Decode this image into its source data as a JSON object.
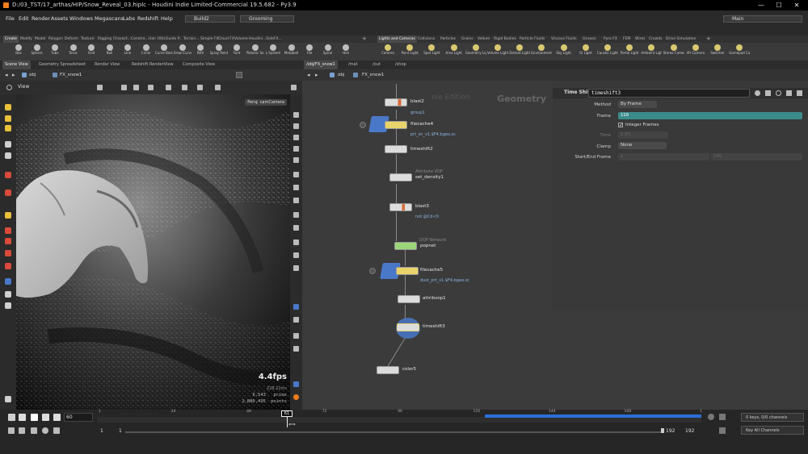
{
  "window": {
    "title": "D:/03_TST/17_arthas/HIP/Snow_Reveal_03.hiplc - Houdini Indie Limited-Commercial 19.5.682 - Py3.9",
    "minimize": "—",
    "maximize": "☐",
    "close": "✕"
  },
  "menu": {
    "items": [
      "File",
      "Edit",
      "Render",
      "Assets",
      "Windows",
      "Megascans",
      "Labs",
      "Redshift",
      "Help"
    ],
    "build": "Build2",
    "desktop": "Grooming",
    "main": "Main"
  },
  "shelf_tabs_left": [
    "Create",
    "Modify",
    "Model",
    "Polygon",
    "Deform",
    "Texture",
    "Rigging",
    "Charact...",
    "Constra...",
    "Hair Utils",
    "Guide P...",
    "Terrain...",
    "Simple FX",
    "Cloud FX",
    "Volume",
    "Houdini...",
    "SideFX..."
  ],
  "shelf_tabs_right": [
    "Lights and Cameras",
    "Collisions",
    "Particles",
    "Grains",
    "Vellum",
    "Rigid Bodies",
    "Particle Fluids",
    "Viscous Fluids",
    "Oceans",
    "Pyro FX",
    "FEM",
    "Wires",
    "Crowds",
    "Drive Simulation"
  ],
  "shelf_tools_left": [
    "Box",
    "Sphere",
    "Tube",
    "Torus",
    "Grid",
    "Null",
    "Line",
    "Circle",
    "Curve Bezier",
    "Draw Curve",
    "Path",
    "Spray Paint",
    "Font",
    "Platonic Solids",
    "L-System",
    "Metaball",
    "File",
    "Spiral",
    "Heli"
  ],
  "shelf_tools_right": [
    "Camera",
    "Point Light",
    "Spot Light",
    "Area Light",
    "Geometry Light",
    "Volume Light",
    "Distant Light",
    "Environment Light",
    "Sky Light",
    "GI Light",
    "Caustic Light",
    "Portal Light",
    "Ambient Light",
    "Stereo Camera",
    "VR Camera",
    "Switcher",
    "Gamepad Camera"
  ],
  "pane_tabs_left": [
    "Scene View",
    "Geometry Spreadsheet",
    "Render View",
    "Redshift RenderView",
    "Composite View"
  ],
  "pane_tabs_right": [
    "/obj/FX_snow1",
    "/mat",
    "/out",
    "/shop"
  ],
  "paths": {
    "left_obj": "obj",
    "left_node": "FX_snow1",
    "right_obj": "obj",
    "right_node": "FX_snow1"
  },
  "viewport": {
    "label": "View",
    "persp": "Persp",
    "camera": "camCamera",
    "fps": "4.4fps",
    "ms": "228.22ms",
    "prims_value": "6,543",
    "prims_label": "prims",
    "points_value": "2,880,495",
    "points_label": "points"
  },
  "network": {
    "context": "Geometry",
    "watermark": "nie Edition",
    "nodes": [
      {
        "name": "blast2",
        "sub": "group1",
        "comment": ""
      },
      {
        "name": "filecache4",
        "sub": "prt_sn_v1.$F4.bgeo.sc",
        "comment": ""
      },
      {
        "name": "timeshift2",
        "sub": "",
        "comment": ""
      },
      {
        "name": "set_density1",
        "sub": "",
        "comment": "Attribute VOP"
      },
      {
        "name": "blast3",
        "sub": "not @Cd<0",
        "comment": ""
      },
      {
        "name": "popnet",
        "sub": "",
        "comment": "DOP Network"
      },
      {
        "name": "filecache5",
        "sub": "dust_prt_v1.$F4.bgeo.sc",
        "comment": ""
      },
      {
        "name": "attribvop1",
        "sub": "",
        "comment": ""
      },
      {
        "name": "timeshift3",
        "sub": "",
        "comment": ""
      },
      {
        "name": "color5",
        "sub": "",
        "comment": ""
      }
    ]
  },
  "params": {
    "node_type": "Time Shift",
    "node_name": "timeshift3",
    "method_label": "Method",
    "method_value": "By Frame",
    "frame_label": "Frame",
    "frame_value": "110",
    "integer_frames_label": "Integer Frames",
    "time_label": "Time",
    "time_value": "1.85",
    "clamp_label": "Clamp",
    "clamp_value": "None",
    "startend_label": "Start/End Frame",
    "start_value": "1",
    "end_value": "240"
  },
  "timeline": {
    "current_frame": "60",
    "playhead_label": "61",
    "ticks": [
      "1",
      "24",
      "48",
      "72",
      "96",
      "120",
      "144",
      "168",
      "1"
    ],
    "start": "1",
    "start2": "1",
    "end": "192",
    "end2": "192",
    "keys_status": "0 keys, 0/0 channels",
    "key_all": "Key All Channels"
  },
  "colors": {
    "accent_orange": "#f07e1f",
    "frame_field": "#3b8b8b",
    "cache_range": "#2a6fd6",
    "node_yellow": "#e8d46a",
    "node_green": "#9bd67a",
    "node_blue": "#4a78c8"
  }
}
